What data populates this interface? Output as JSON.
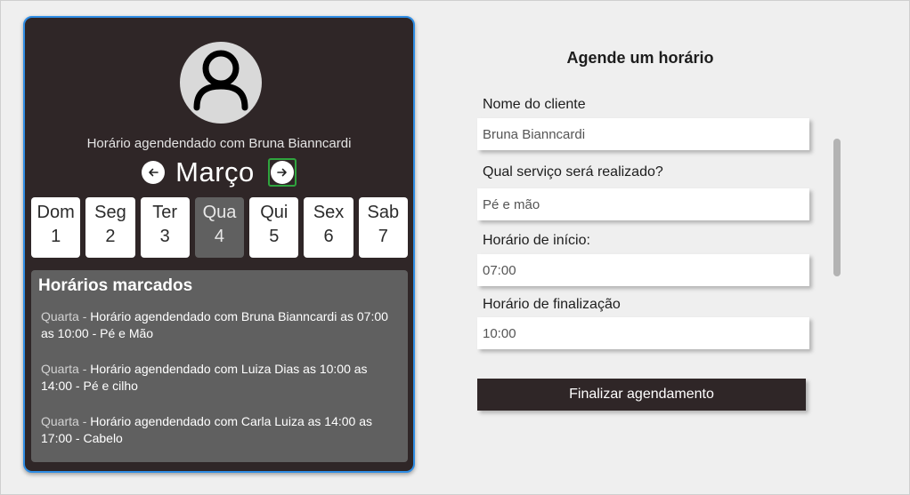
{
  "profile": {
    "subtitle": "Horário agendendado com Bruna Bianncardi",
    "avatar_icon": "user-icon"
  },
  "calendar": {
    "month": "Março",
    "prev_icon": "arrow-left-icon",
    "next_icon": "arrow-right-icon",
    "days": [
      {
        "name": "Dom",
        "num": "1"
      },
      {
        "name": "Seg",
        "num": "2"
      },
      {
        "name": "Ter",
        "num": "3"
      },
      {
        "name": "Qua",
        "num": "4",
        "active": true
      },
      {
        "name": "Qui",
        "num": "5"
      },
      {
        "name": "Sex",
        "num": "6"
      },
      {
        "name": "Sab",
        "num": "7"
      }
    ]
  },
  "booked": {
    "title": "Horários marcados",
    "items": [
      {
        "weekday": "Quarta - ",
        "text": "Horário agendendado com Bruna Bianncardi as 07:00 as 10:00 - Pé e Mão"
      },
      {
        "weekday": "Quarta - ",
        "text": "Horário agendendado com Luiza Dias as 10:00 as 14:00 - Pé e cilho"
      },
      {
        "weekday": "Quarta - ",
        "text": "Horário agendendado com Carla Luiza as 14:00 as 17:00 - Cabelo"
      }
    ]
  },
  "form": {
    "title": "Agende um horário",
    "client_label": "Nome do cliente",
    "client_value": "Bruna Bianncardi",
    "service_label": "Qual serviço será realizado?",
    "service_value": "Pé e mão",
    "start_label": "Horário de início:",
    "start_value": "07:00",
    "end_label": "Horário de finalização",
    "end_value": "10:00",
    "submit_label": "Finalizar agendamento"
  },
  "colors": {
    "card_bg": "#2f2627",
    "card_border": "#2f8de4",
    "active_day": "#606060",
    "button_bg": "#2f2627"
  }
}
